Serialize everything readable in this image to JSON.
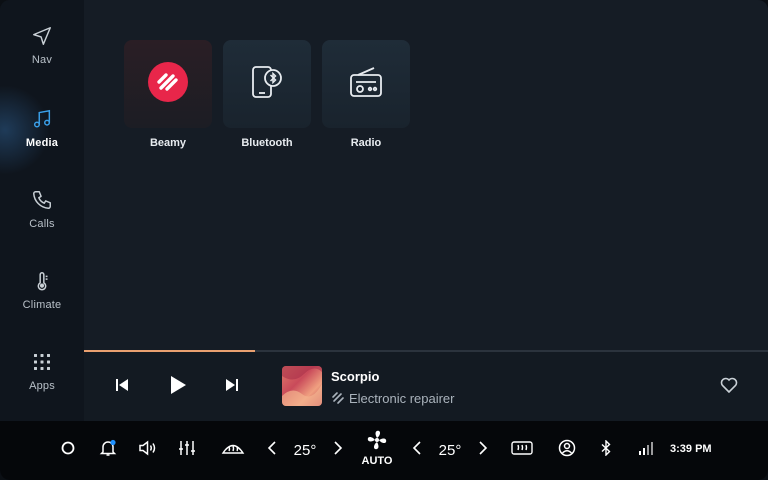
{
  "sidebar": {
    "items": [
      {
        "id": "nav",
        "label": "Nav",
        "icon": "navigation-arrow-icon"
      },
      {
        "id": "media",
        "label": "Media",
        "icon": "music-note-icon",
        "active": true
      },
      {
        "id": "calls",
        "label": "Calls",
        "icon": "phone-icon"
      },
      {
        "id": "climate",
        "label": "Climate",
        "icon": "thermometer-icon"
      },
      {
        "id": "apps",
        "label": "Apps",
        "icon": "grid-icon"
      }
    ]
  },
  "media_sources": [
    {
      "label": "Beamy",
      "icon": "beamy-logo-icon"
    },
    {
      "label": "Bluetooth",
      "icon": "phone-bluetooth-icon"
    },
    {
      "label": "Radio",
      "icon": "radio-icon"
    }
  ],
  "player": {
    "title": "Scorpio",
    "artist": "Electronic repairer",
    "progress": 0.25,
    "accent": "#e9a070"
  },
  "bottom_bar": {
    "left_temp": "25°",
    "right_temp": "25°",
    "fan_mode": "AUTO",
    "time": "3:39 PM",
    "notification_dot_color": "#1e90ff"
  }
}
